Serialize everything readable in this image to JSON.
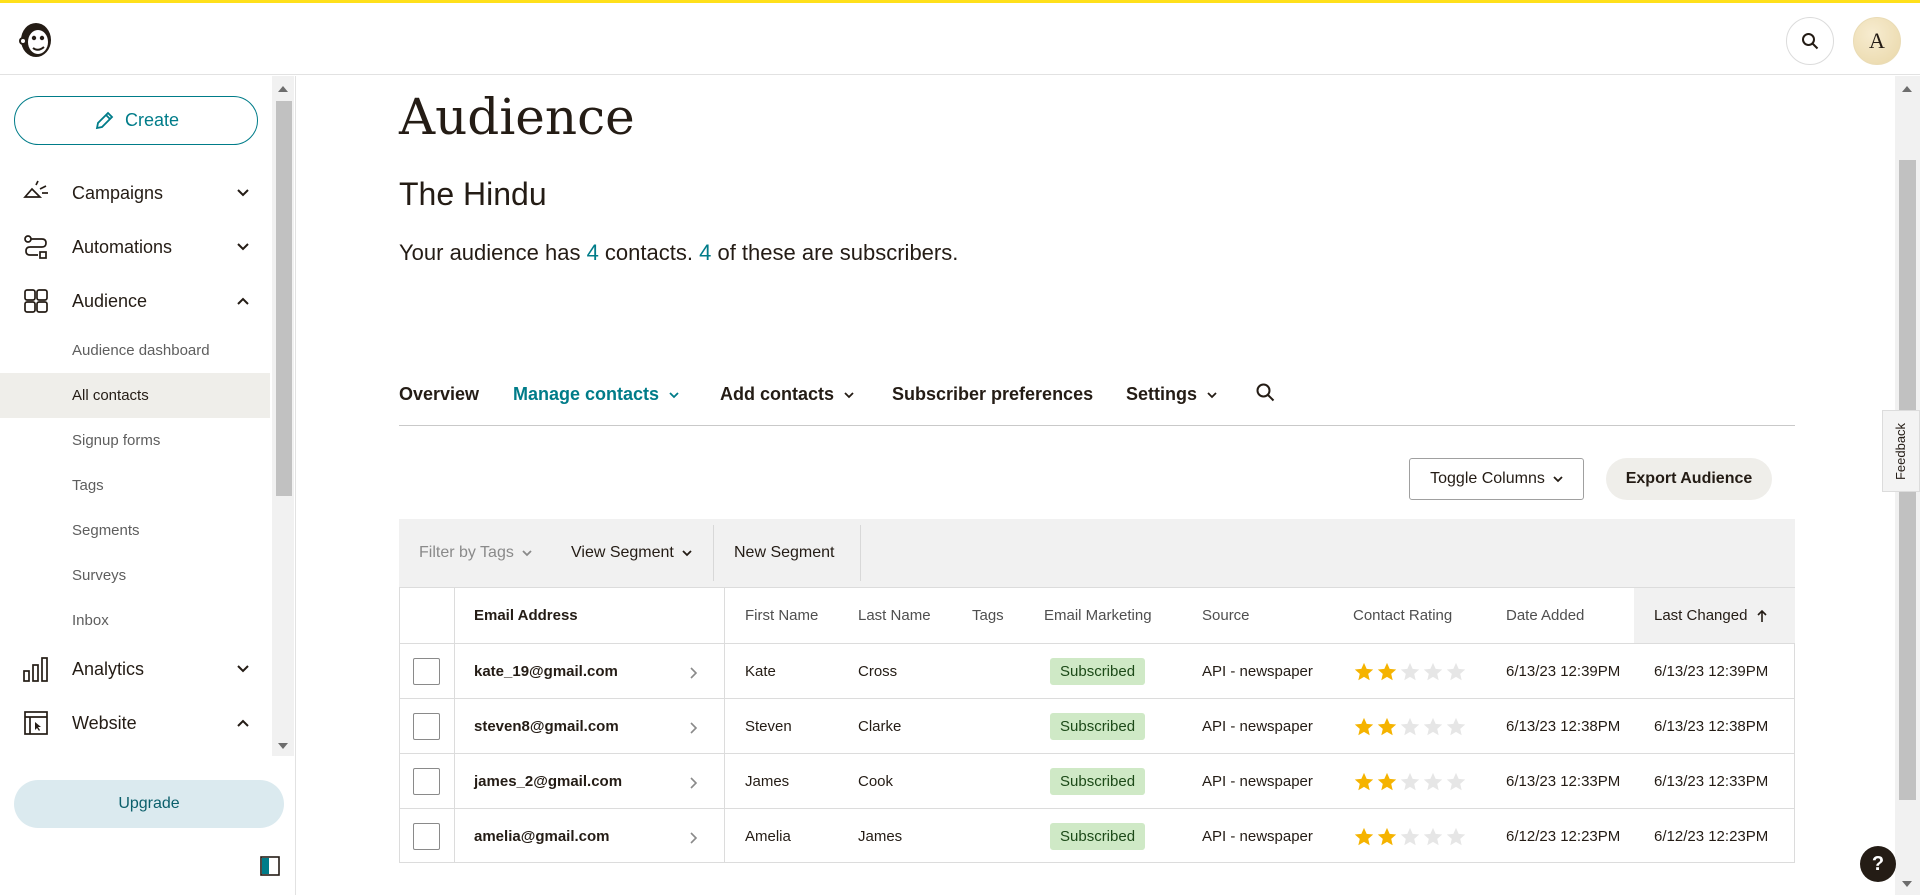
{
  "topbar": {
    "avatar_letter": "A"
  },
  "sidebar": {
    "create_label": "Create",
    "items": [
      {
        "label": "Campaigns"
      },
      {
        "label": "Automations"
      },
      {
        "label": "Audience"
      },
      {
        "label": "Analytics"
      },
      {
        "label": "Website"
      }
    ],
    "sub_items": [
      "Audience dashboard",
      "All contacts",
      "Signup forms",
      "Tags",
      "Segments",
      "Surveys",
      "Inbox"
    ],
    "upgrade_label": "Upgrade"
  },
  "main": {
    "title": "Audience",
    "audience_name": "The Hindu",
    "summary": {
      "prefix": "Your audience has ",
      "contacts": "4",
      "middle": " contacts. ",
      "subscribers": "4",
      "suffix": " of these are subscribers."
    },
    "tabs": [
      "Overview",
      "Manage contacts",
      "Add contacts",
      "Subscriber preferences",
      "Settings"
    ],
    "toggle_columns": "Toggle Columns",
    "export_audience": "Export Audience",
    "filter_by_tags": "Filter by Tags",
    "view_segment": "View Segment",
    "new_segment": "New Segment"
  },
  "table": {
    "headers": [
      "Email Address",
      "First Name",
      "Last Name",
      "Tags",
      "Email Marketing",
      "Source",
      "Contact Rating",
      "Date Added",
      "Last Changed"
    ],
    "rows": [
      {
        "email": "kate_19@gmail.com",
        "first": "Kate",
        "last": "Cross",
        "status": "Subscribed",
        "source": "API - newspaper",
        "rating": 2,
        "added": "6/13/23 12:39PM",
        "changed": "6/13/23 12:39PM"
      },
      {
        "email": "steven8@gmail.com",
        "first": "Steven",
        "last": "Clarke",
        "status": "Subscribed",
        "source": "API - newspaper",
        "rating": 2,
        "added": "6/13/23 12:38PM",
        "changed": "6/13/23 12:38PM"
      },
      {
        "email": "james_2@gmail.com",
        "first": "James",
        "last": "Cook",
        "status": "Subscribed",
        "source": "API - newspaper",
        "rating": 2,
        "added": "6/13/23 12:33PM",
        "changed": "6/13/23 12:33PM"
      },
      {
        "email": "amelia@gmail.com",
        "first": "Amelia",
        "last": "James",
        "status": "Subscribed",
        "source": "API - newspaper",
        "rating": 2,
        "added": "6/12/23 12:23PM",
        "changed": "6/12/23 12:23PM"
      }
    ]
  },
  "feedback_label": "Feedback",
  "help_label": "?",
  "colors": {
    "accent": "#007c89",
    "brand_yellow": "#ffe01b",
    "star": "#f5b300",
    "subscribed_bg": "#cfe9c6"
  }
}
